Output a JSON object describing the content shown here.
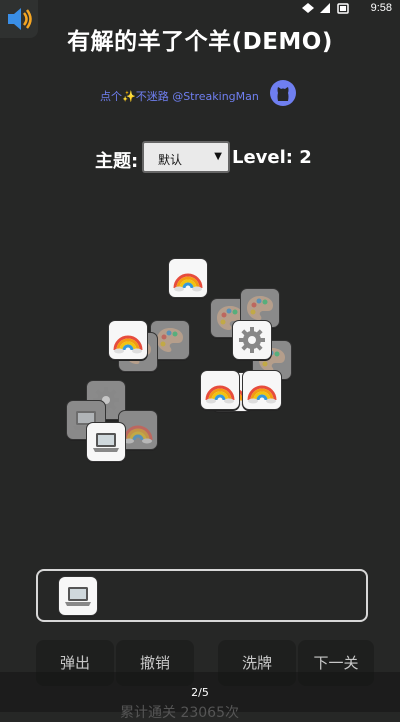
{
  "status_bar": {
    "time": "9:58"
  },
  "header": {
    "title": "有解的羊了个羊(DEMO)"
  },
  "promo": {
    "text": "点个✨不迷路 @StreakingMan"
  },
  "controls": {
    "theme_label": "主题:",
    "theme_value": "默认",
    "level_text": "Level: 2"
  },
  "board": {
    "tiles": [
      {
        "icon": "rainbow-icon",
        "state": "active"
      },
      {
        "icon": "palette-icon",
        "state": "dim"
      },
      {
        "icon": "palette-icon",
        "state": "dim"
      },
      {
        "icon": "rainbow-icon",
        "state": "active"
      },
      {
        "icon": "palette-icon",
        "state": "dim"
      },
      {
        "icon": "gear-icon",
        "state": "active"
      },
      {
        "icon": "palette-icon",
        "state": "dim"
      },
      {
        "icon": "rainbow-icon",
        "state": "active"
      },
      {
        "icon": "rainbow-icon",
        "state": "active"
      },
      {
        "icon": "gear-icon",
        "state": "dim"
      },
      {
        "icon": "laptop-icon",
        "state": "dim"
      },
      {
        "icon": "rainbow-icon",
        "state": "dim"
      },
      {
        "icon": "laptop-icon",
        "state": "active"
      }
    ]
  },
  "slot": {
    "items": [
      {
        "icon": "laptop-icon"
      }
    ]
  },
  "actions": {
    "pop": "弹出",
    "undo": "撤销",
    "shuffle": "洗牌",
    "next": "下一关"
  },
  "pager": {
    "text": "2/5"
  },
  "counter": {
    "text": "累计通关 23065次"
  },
  "colors": {
    "background": "#262726",
    "promo_link": "#6f7ff0",
    "tile_face": "#f7f7f7"
  }
}
